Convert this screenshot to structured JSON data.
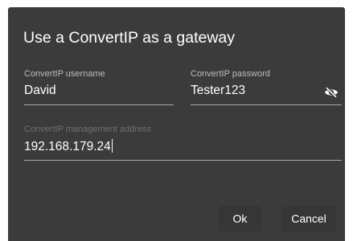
{
  "dialog": {
    "title": "Use a ConvertIP as a gateway",
    "username": {
      "label": "ConvertIP username",
      "value": "David"
    },
    "password": {
      "label": "ConvertIP password",
      "value": "Tester123",
      "toggle_icon": "eye-off-icon"
    },
    "address": {
      "label": "ConvertIP management address",
      "value": "192.168.179.24"
    },
    "buttons": {
      "ok_label": "Ok",
      "cancel_label": "Cancel"
    }
  },
  "colors": {
    "dialog_background": "#3b3b3b",
    "label": "#bdbdbd",
    "label_inactive": "#6f6f6f",
    "text": "#ffffff",
    "underline": "#a8a8a8"
  }
}
